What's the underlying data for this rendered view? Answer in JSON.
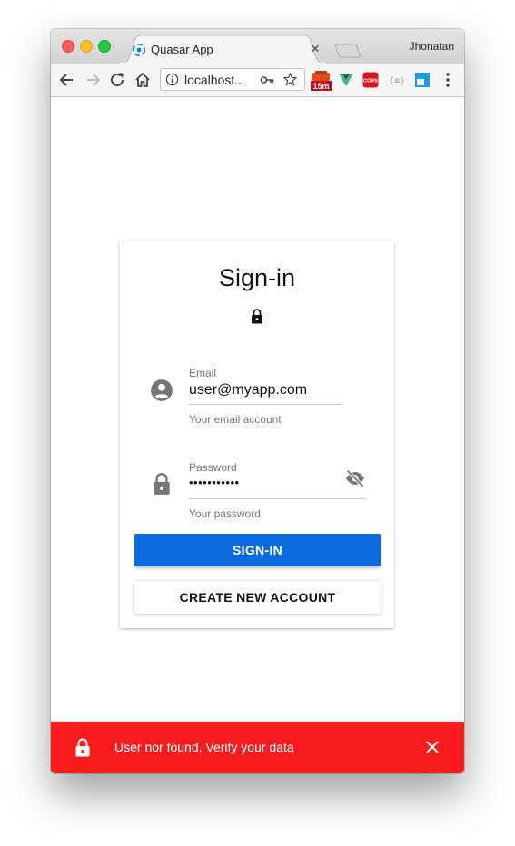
{
  "browser": {
    "tab_title": "Quasar App",
    "tab_close": "×",
    "profile_name": "Jhonatan",
    "url": "localhost...",
    "extensions": {
      "timer_badge": "15m",
      "cors_label": "CORS",
      "json_label": "{≡}"
    }
  },
  "signin": {
    "title": "Sign-in",
    "email": {
      "label": "Email",
      "value": "user@myapp.com",
      "hint": "Your email account"
    },
    "password": {
      "label": "Password",
      "value": "•••••••••••",
      "hint": "Your password"
    },
    "signin_button": "SIGN-IN",
    "create_account_button": "CREATE NEW ACCOUNT"
  },
  "notification": {
    "message": "User nor found. Verify your data"
  },
  "colors": {
    "primary": "#0b6bdd",
    "negative": "#fb1c20"
  }
}
